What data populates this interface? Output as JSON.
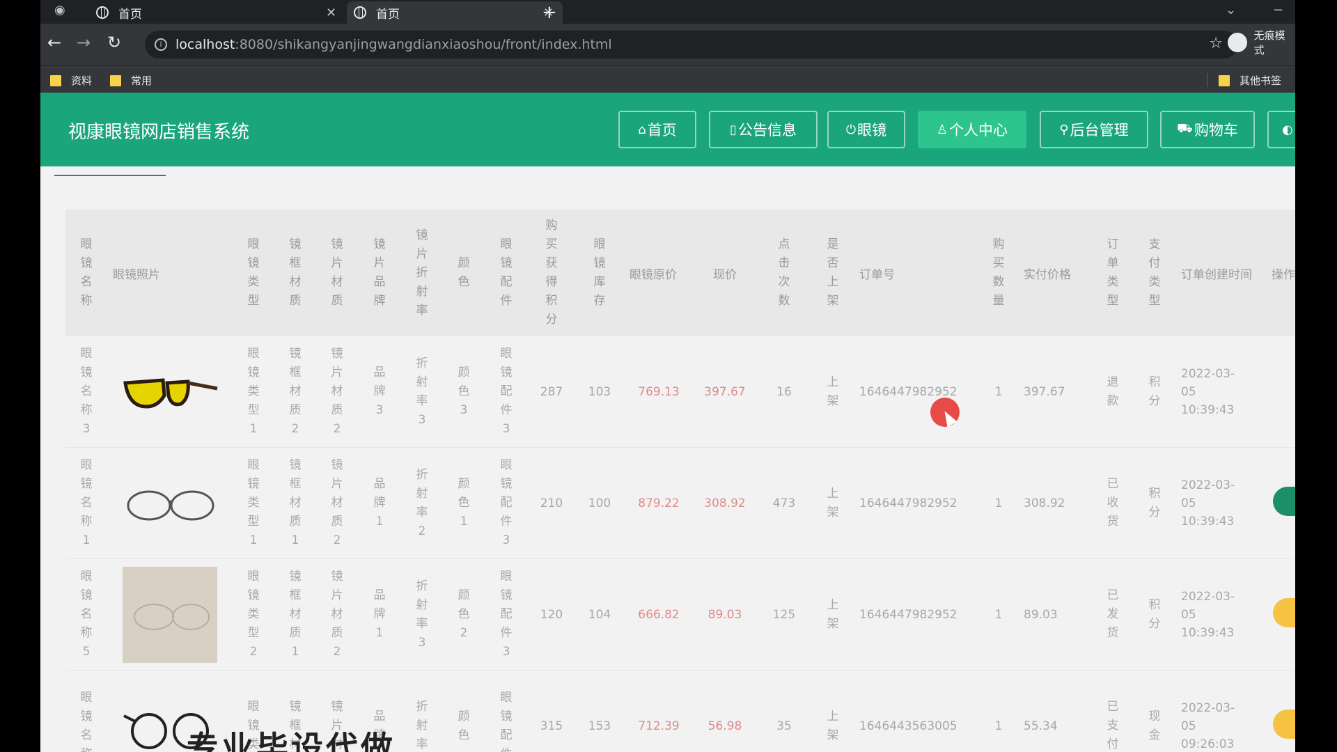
{
  "browser": {
    "tabs": [
      {
        "label": "首页",
        "active": false
      },
      {
        "label": "首页",
        "active": true
      }
    ],
    "url_host": "localhost",
    "url_path": ":8080/shikangyanjingwangdianxiaoshou/front/index.html",
    "profile_label": "无痕模式",
    "bookmarks": [
      {
        "label": "资料"
      },
      {
        "label": "常用"
      },
      {
        "label": "其他书签"
      }
    ]
  },
  "site": {
    "title": "视康眼镜网店销售系统",
    "nav": [
      {
        "label": "首页",
        "icon": "home-icon",
        "glyph": "⌂",
        "active": false
      },
      {
        "label": "公告信息",
        "icon": "notice-icon",
        "glyph": "▯",
        "active": false
      },
      {
        "label": "眼镜",
        "icon": "power-icon",
        "glyph": "⏻",
        "active": false
      },
      {
        "label": "个人中心",
        "icon": "person-icon",
        "glyph": "♙",
        "active": true
      },
      {
        "label": "后台管理",
        "icon": "link-icon",
        "glyph": "⚲",
        "active": false
      },
      {
        "label": "购物车",
        "icon": "cart-icon",
        "glyph": "⛟",
        "active": false
      }
    ]
  },
  "table": {
    "headers": [
      "眼镜名称",
      "眼镜照片",
      "眼镜类型",
      "镜框材质",
      "镜片材质",
      "镜片品牌",
      "镜片折射率",
      "颜色",
      "眼镜配件",
      "购买获得积分",
      "眼镜库存",
      "眼镜原价",
      "现价",
      "点击次数",
      "是否上架",
      "订单号",
      "购买数量",
      "实付价格",
      "订单类型",
      "支付类型",
      "订单创建时间",
      "操作"
    ],
    "rows": [
      {
        "name": "眼镜名称3",
        "photo": "sunglasses-photo",
        "type": "眼镜类型1",
        "frame": "镜框材质2",
        "lens": "镜片材质2",
        "brand": "品牌3",
        "refr": "折射率3",
        "color": "颜色3",
        "acc": "眼镜配件3",
        "points": "287",
        "stock": "103",
        "orig": "769.13",
        "price": "397.67",
        "clicks": "16",
        "shelf": "上架",
        "order_no": "1646447982952",
        "qty": "1",
        "paid": "397.67",
        "otype": "退款",
        "ptype": "积分",
        "time": "2022-03-05 10:39:43",
        "op": "none"
      },
      {
        "name": "眼镜名称1",
        "photo": "glasses-photo",
        "type": "眼镜类型1",
        "frame": "镜框材质1",
        "lens": "镜片材质2",
        "brand": "品牌1",
        "refr": "折射率2",
        "color": "颜色1",
        "acc": "眼镜配件3",
        "points": "210",
        "stock": "100",
        "orig": "879.22",
        "price": "308.92",
        "clicks": "473",
        "shelf": "上架",
        "order_no": "1646447982952",
        "qty": "1",
        "paid": "308.92",
        "otype": "已收货",
        "ptype": "积分",
        "time": "2022-03-05 10:39:43",
        "op": "green"
      },
      {
        "name": "眼镜名称5",
        "photo": "boxed-glasses-photo",
        "type": "眼镜类型2",
        "frame": "镜框材质1",
        "lens": "镜片材质2",
        "brand": "品牌1",
        "refr": "折射率3",
        "color": "颜色2",
        "acc": "眼镜配件3",
        "points": "120",
        "stock": "104",
        "orig": "666.82",
        "price": "89.03",
        "clicks": "125",
        "shelf": "上架",
        "order_no": "1646447982952",
        "qty": "1",
        "paid": "89.03",
        "otype": "已发货",
        "ptype": "积分",
        "time": "2022-03-05 10:39:43",
        "op": "orange"
      },
      {
        "name": "眼镜名称",
        "photo": "round-glasses-photo",
        "type": "眼镜类",
        "frame": "镜框材",
        "lens": "镜片材",
        "brand": "品牌",
        "refr": "折射率",
        "color": "颜色",
        "acc": "眼镜配件",
        "points": "315",
        "stock": "153",
        "orig": "712.39",
        "price": "56.98",
        "clicks": "35",
        "shelf": "上架",
        "order_no": "1646443563005",
        "qty": "1",
        "paid": "55.34",
        "otype": "已支付",
        "ptype": "现金",
        "time": "2022-03-05 09:26:03",
        "op": "orange"
      }
    ]
  },
  "overlay_caption": "专业毕设代做"
}
